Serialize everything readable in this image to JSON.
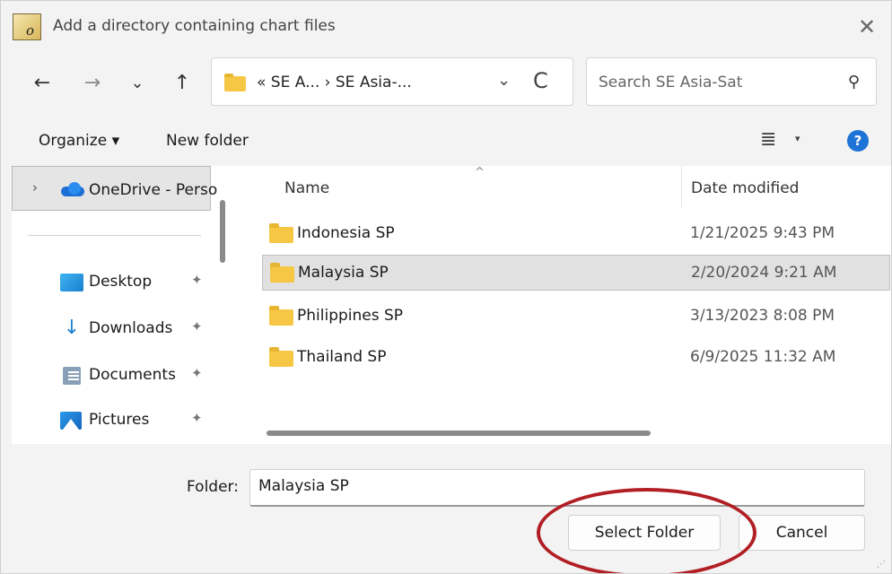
{
  "window": {
    "title": "Add a directory containing chart files",
    "app_icon_letter": "o"
  },
  "nav": {
    "back_icon": "←",
    "forward_icon": "→",
    "recent_icon": "⌄",
    "up_icon": "↑",
    "address_path": "« SE A...  ›  SE Asia-...",
    "address_dropdown_icon": "⌄",
    "refresh_icon": "C",
    "search_placeholder": "Search SE Asia-Sat",
    "search_icon": "⚲"
  },
  "toolbar": {
    "organize_label": "Organize ▾",
    "new_folder_label": "New folder",
    "view_icon": "≣",
    "view_caret": "▾",
    "help_icon": "?"
  },
  "sidebar": {
    "onedrive_label": "OneDrive - Perso",
    "items": [
      {
        "label": "Desktop",
        "icon": "desktop-icon"
      },
      {
        "label": "Downloads",
        "icon": "downloads-icon"
      },
      {
        "label": "Documents",
        "icon": "documents-icon"
      },
      {
        "label": "Pictures",
        "icon": "pictures-icon"
      }
    ],
    "pin_glyph": "📌"
  },
  "files": {
    "col_name": "Name",
    "col_date": "Date modified",
    "sort_indicator": "^",
    "rows": [
      {
        "name": "Indonesia SP",
        "date": "1/21/2025 9:43 PM",
        "selected": false
      },
      {
        "name": "Malaysia SP",
        "date": "2/20/2024 9:21 AM",
        "selected": true
      },
      {
        "name": "Philippines SP",
        "date": "3/13/2023 8:08 PM",
        "selected": false
      },
      {
        "name": "Thailand SP",
        "date": "6/9/2025 11:32 AM",
        "selected": false
      }
    ]
  },
  "footer": {
    "folder_label": "Folder:",
    "folder_value": "Malaysia SP",
    "select_button": "Select Folder",
    "cancel_button": "Cancel"
  },
  "colors": {
    "highlight_ellipse": "#b11f24",
    "folder_yellow": "#f6c744",
    "selection_bg": "#e1e1e1"
  }
}
